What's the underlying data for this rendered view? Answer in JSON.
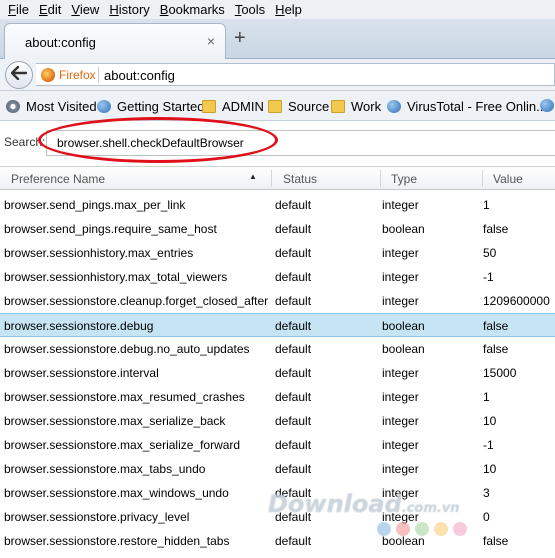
{
  "menubar": {
    "items": [
      {
        "label": "File",
        "key": "F",
        "rest": "ile"
      },
      {
        "label": "Edit",
        "key": "E",
        "rest": "dit"
      },
      {
        "label": "View",
        "key": "V",
        "rest": "iew"
      },
      {
        "label": "History",
        "key": "H",
        "rest": "istory"
      },
      {
        "label": "Bookmarks",
        "key": "B",
        "rest": "ookmarks"
      },
      {
        "label": "Tools",
        "key": "T",
        "rest": "ools"
      },
      {
        "label": "Help",
        "key": "H",
        "rest": "elp"
      }
    ]
  },
  "tabs": {
    "active_tab_title": "about:config",
    "close_glyph": "×",
    "new_tab_glyph": "+"
  },
  "navbar": {
    "back_glyph": "🡐",
    "identity_label": "Firefox",
    "url": "about:config"
  },
  "bookmarks": {
    "items": [
      {
        "label": "Most Visited",
        "icon": "gear-icon"
      },
      {
        "label": "Getting Started",
        "icon": "globe-icon"
      },
      {
        "label": "ADMIN",
        "icon": "folder-icon"
      },
      {
        "label": "Source",
        "icon": "folder-icon"
      },
      {
        "label": "Work",
        "icon": "folder-icon"
      },
      {
        "label": "VirusTotal - Free Onlin...",
        "icon": "globe-icon"
      }
    ]
  },
  "search": {
    "label": "Search:",
    "value": "browser.shell.checkDefaultBrowser"
  },
  "table": {
    "headers": {
      "name": "Preference Name",
      "status": "Status",
      "type": "Type",
      "value": "Value"
    },
    "sort_indicator": "▲",
    "rows": [
      {
        "name": "browser.send_pings.max_per_link",
        "status": "default",
        "type": "integer",
        "value": "1"
      },
      {
        "name": "browser.send_pings.require_same_host",
        "status": "default",
        "type": "boolean",
        "value": "false"
      },
      {
        "name": "browser.sessionhistory.max_entries",
        "status": "default",
        "type": "integer",
        "value": "50"
      },
      {
        "name": "browser.sessionhistory.max_total_viewers",
        "status": "default",
        "type": "integer",
        "value": "-1"
      },
      {
        "name": "browser.sessionstore.cleanup.forget_closed_after",
        "status": "default",
        "type": "integer",
        "value": "1209600000"
      },
      {
        "name": "browser.sessionstore.debug",
        "status": "default",
        "type": "boolean",
        "value": "false"
      },
      {
        "name": "browser.sessionstore.debug.no_auto_updates",
        "status": "default",
        "type": "boolean",
        "value": "false"
      },
      {
        "name": "browser.sessionstore.interval",
        "status": "default",
        "type": "integer",
        "value": "15000"
      },
      {
        "name": "browser.sessionstore.max_resumed_crashes",
        "status": "default",
        "type": "integer",
        "value": "1"
      },
      {
        "name": "browser.sessionstore.max_serialize_back",
        "status": "default",
        "type": "integer",
        "value": "10"
      },
      {
        "name": "browser.sessionstore.max_serialize_forward",
        "status": "default",
        "type": "integer",
        "value": "-1"
      },
      {
        "name": "browser.sessionstore.max_tabs_undo",
        "status": "default",
        "type": "integer",
        "value": "10"
      },
      {
        "name": "browser.sessionstore.max_windows_undo",
        "status": "default",
        "type": "integer",
        "value": "3"
      },
      {
        "name": "browser.sessionstore.privacy_level",
        "status": "default",
        "type": "integer",
        "value": "0"
      },
      {
        "name": "browser.sessionstore.restore_hidden_tabs",
        "status": "default",
        "type": "boolean",
        "value": "false"
      }
    ]
  },
  "selected_row_index": 5,
  "watermark": {
    "text": "Download",
    "tld": ".com.vn"
  },
  "colors": {
    "highlight_ellipse": "#e0101a",
    "selected_row": "#c7e4f4",
    "identity": "#e06a10",
    "watermark_dots": [
      "#7fb3e0",
      "#f28a8a",
      "#9ed59a",
      "#f7c96a",
      "#f2a0c0"
    ]
  }
}
